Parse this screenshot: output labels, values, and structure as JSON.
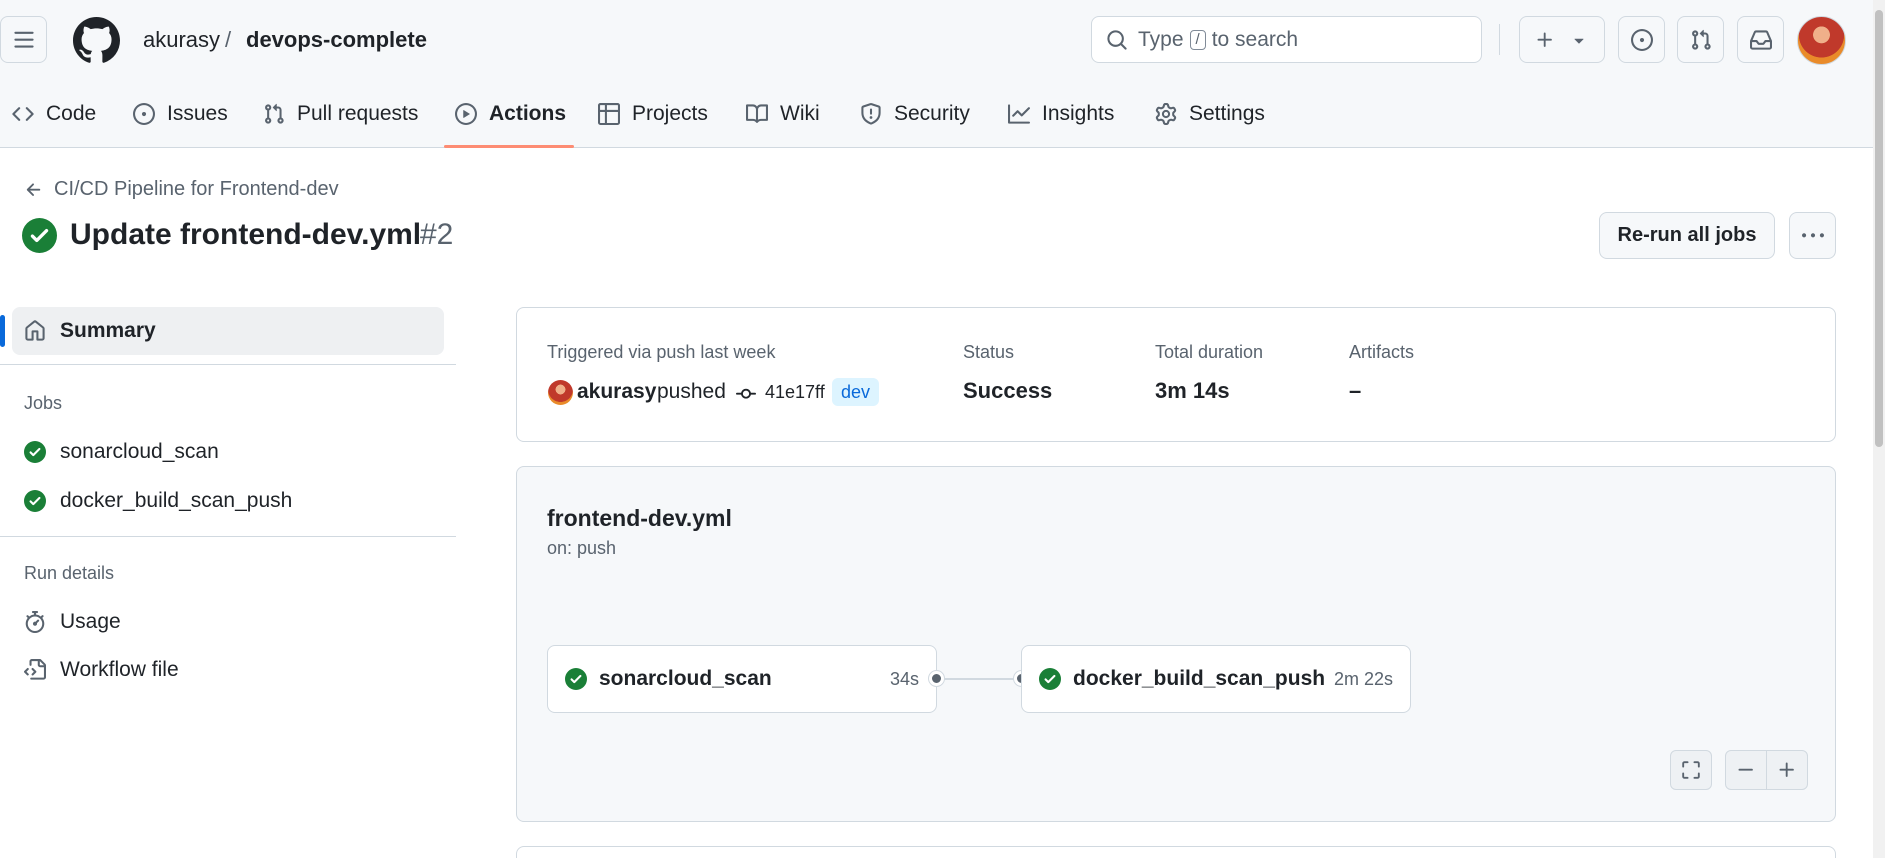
{
  "header": {
    "owner": "akurasy",
    "separator": "/",
    "repo": "devops-complete",
    "search_prefix": "Type",
    "search_key": "/",
    "search_suffix": "to search"
  },
  "tabs": [
    {
      "label": "Code",
      "icon": "code-icon"
    },
    {
      "label": "Issues",
      "icon": "issue-opened-icon"
    },
    {
      "label": "Pull requests",
      "icon": "git-pull-request-icon"
    },
    {
      "label": "Actions",
      "icon": "play-icon",
      "active": true
    },
    {
      "label": "Projects",
      "icon": "table-icon"
    },
    {
      "label": "Wiki",
      "icon": "book-icon"
    },
    {
      "label": "Security",
      "icon": "shield-icon"
    },
    {
      "label": "Insights",
      "icon": "graph-icon"
    },
    {
      "label": "Settings",
      "icon": "gear-icon"
    }
  ],
  "run": {
    "back_link": "CI/CD Pipeline for Frontend-dev",
    "title": "Update frontend-dev.yml",
    "number": "#2",
    "rerun_label": "Re-run all jobs"
  },
  "sidebar": {
    "summary_label": "Summary",
    "jobs_heading": "Jobs",
    "jobs": [
      "sonarcloud_scan",
      "docker_build_scan_push"
    ],
    "run_details_heading": "Run details",
    "usage_label": "Usage",
    "workflow_file_label": "Workflow file"
  },
  "summary": {
    "trigger_label": "Triggered via push last week",
    "user": "akurasy",
    "action": "pushed",
    "sha": "41e17ff",
    "branch": "dev",
    "status_label": "Status",
    "status_value": "Success",
    "duration_label": "Total duration",
    "duration_value": "3m 14s",
    "artifacts_label": "Artifacts",
    "artifacts_value": "–"
  },
  "graph": {
    "workflow_file": "frontend-dev.yml",
    "trigger": "on: push",
    "jobs": [
      {
        "name": "sonarcloud_scan",
        "duration": "34s"
      },
      {
        "name": "docker_build_scan_push",
        "duration": "2m 22s"
      }
    ]
  },
  "colors": {
    "success": "#1a7f37",
    "accent_underline": "#fd8c73",
    "link_blue": "#0969da"
  }
}
